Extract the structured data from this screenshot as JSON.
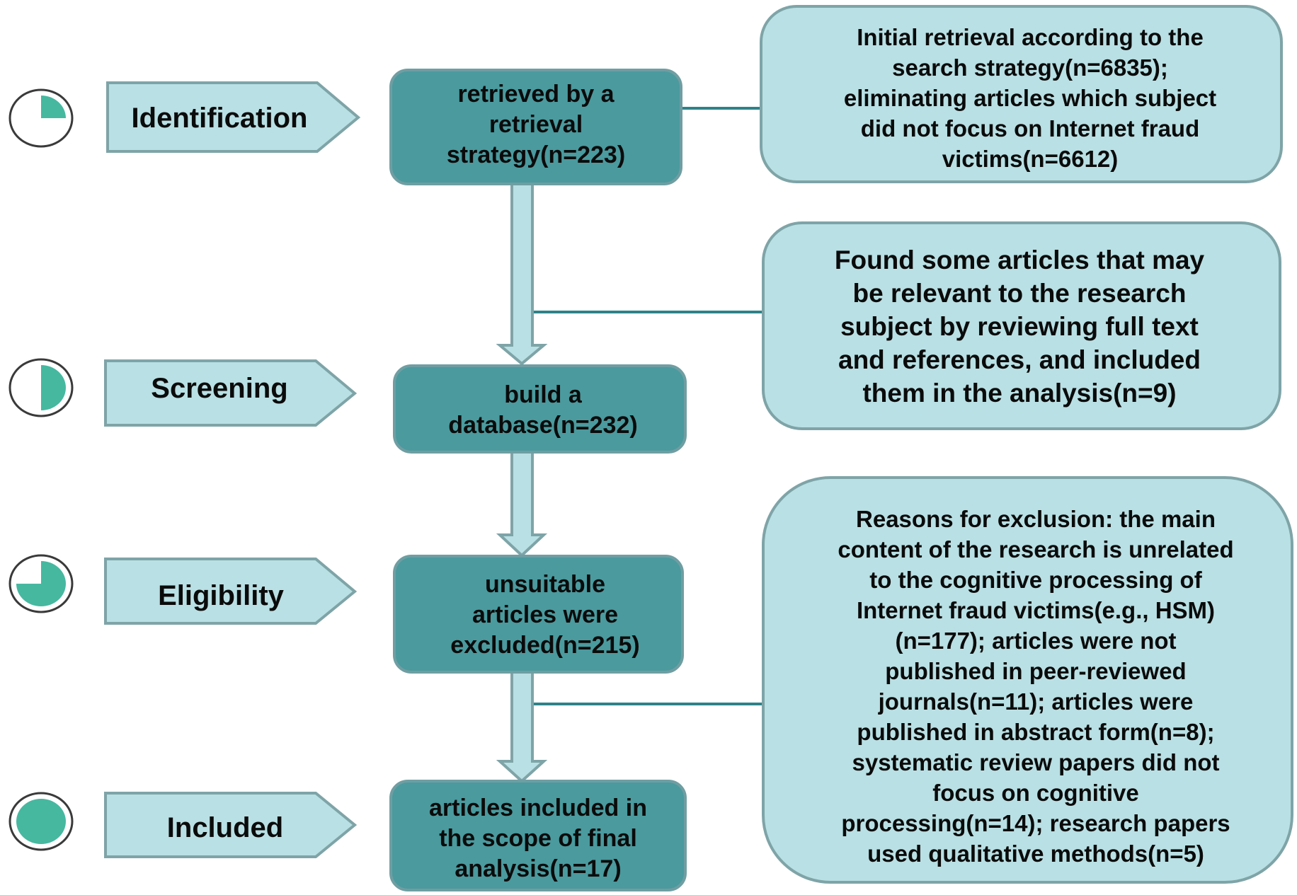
{
  "colors": {
    "main_box_fill": "#4a9a9e",
    "main_box_stroke": "#6f9ea2",
    "light_fill": "#b9e0e4",
    "light_stroke": "#7fa4a8",
    "connector": "#2e8289",
    "progress_fill": "#46b8a0",
    "progress_ring": "#3a3a3a",
    "text": "#0b0b0b"
  },
  "stages": [
    {
      "id": "identification",
      "label": "Identification",
      "progress": 0.25
    },
    {
      "id": "screening",
      "label": "Screening",
      "progress": 0.5
    },
    {
      "id": "eligibility",
      "label": "Eligibility",
      "progress": 0.75
    },
    {
      "id": "included",
      "label": "Included",
      "progress": 1.0
    }
  ],
  "main_boxes": [
    {
      "id": "retrieved",
      "lines": [
        "retrieved by a",
        "retrieval",
        "strategy(n=223)"
      ]
    },
    {
      "id": "database",
      "lines": [
        "build a",
        "database(n=232)"
      ]
    },
    {
      "id": "excluded",
      "lines": [
        "unsuitable",
        "articles were",
        "excluded(n=215)"
      ]
    },
    {
      "id": "final",
      "lines": [
        "articles included in",
        "the scope of final",
        "analysis(n=17)"
      ]
    }
  ],
  "side_boxes": [
    {
      "id": "initial-retrieval",
      "lines": [
        "Initial retrieval according to the",
        "search strategy(n=6835);",
        "eliminating articles which subject",
        "did not focus on Internet fraud",
        "victims(n=6612)"
      ]
    },
    {
      "id": "found-articles",
      "lines": [
        "Found some articles that may",
        "be relevant to the research",
        "subject by reviewing full text",
        "and references, and included",
        "them in the analysis(n=9)"
      ]
    },
    {
      "id": "exclusion-reasons",
      "lines": [
        "Reasons for exclusion: the main",
        "content of the research is unrelated",
        "to the cognitive processing of",
        "Internet fraud victims(e.g., HSM)",
        "(n=177); articles were not",
        "published in peer-reviewed",
        "journals(n=11); articles were",
        "published in abstract form(n=8);",
        "systematic review papers did not",
        "focus on cognitive",
        "processing(n=14); research papers",
        "used qualitative methods(n=5)"
      ]
    }
  ]
}
